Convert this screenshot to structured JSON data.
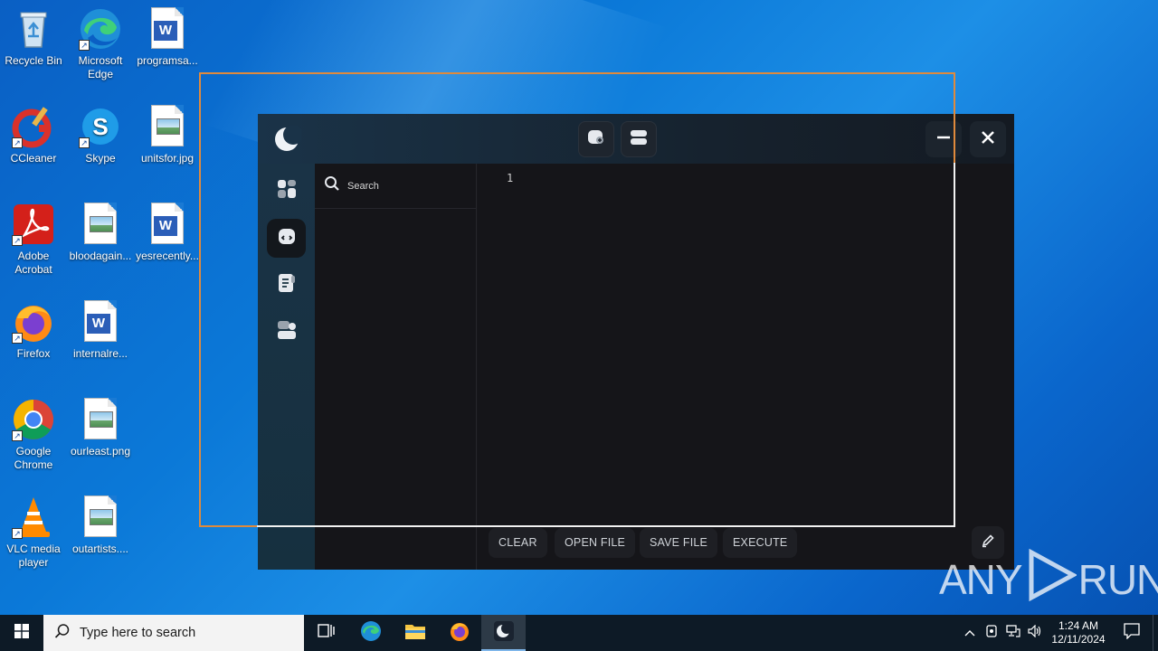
{
  "desktop": {
    "icons": [
      {
        "name": "recycle-bin-icon",
        "label": "Recycle Bin"
      },
      {
        "name": "microsoft-edge-icon",
        "label": "Microsoft Edge"
      },
      {
        "name": "word-document-icon",
        "label": "programsa..."
      },
      {
        "name": "ccleaner-icon",
        "label": "CCleaner"
      },
      {
        "name": "skype-icon",
        "label": "Skype"
      },
      {
        "name": "image-file-icon",
        "label": "unitsfor.jpg"
      },
      {
        "name": "adobe-acrobat-icon",
        "label": "Adobe Acrobat"
      },
      {
        "name": "image-file-icon",
        "label": "bloodagain..."
      },
      {
        "name": "word-document-icon",
        "label": "yesrecently..."
      },
      {
        "name": "firefox-icon",
        "label": "Firefox"
      },
      {
        "name": "word-document-icon",
        "label": "internalre..."
      },
      {
        "name": "google-chrome-icon",
        "label": "Google Chrome"
      },
      {
        "name": "image-file-icon",
        "label": "ourleast.png"
      },
      {
        "name": "vlc-icon",
        "label": "VLC media player"
      },
      {
        "name": "image-file-icon",
        "label": "outartists...."
      }
    ]
  },
  "app": {
    "search_label": "Search",
    "line_number": "1",
    "actions": {
      "clear": "CLEAR",
      "open_file": "OPEN FILE",
      "save_file": "SAVE FILE",
      "execute": "EXECUTE"
    },
    "status_color": "#ff3b3b"
  },
  "watermark": {
    "left": "ANY",
    "right": "RUN"
  },
  "taskbar": {
    "search_placeholder": "Type here to search",
    "time": "1:24 AM",
    "date": "12/11/2024"
  }
}
